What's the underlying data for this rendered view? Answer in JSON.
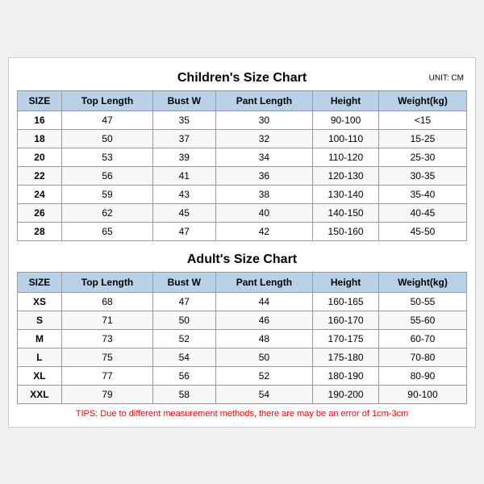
{
  "children": {
    "title": "Children's Size Chart",
    "unit": "UNIT: CM",
    "headers": [
      "SIZE",
      "Top Length",
      "Bust W",
      "Pant Length",
      "Height",
      "Weight(kg)"
    ],
    "rows": [
      [
        "16",
        "47",
        "35",
        "30",
        "90-100",
        "<15"
      ],
      [
        "18",
        "50",
        "37",
        "32",
        "100-110",
        "15-25"
      ],
      [
        "20",
        "53",
        "39",
        "34",
        "110-120",
        "25-30"
      ],
      [
        "22",
        "56",
        "41",
        "36",
        "120-130",
        "30-35"
      ],
      [
        "24",
        "59",
        "43",
        "38",
        "130-140",
        "35-40"
      ],
      [
        "26",
        "62",
        "45",
        "40",
        "140-150",
        "40-45"
      ],
      [
        "28",
        "65",
        "47",
        "42",
        "150-160",
        "45-50"
      ]
    ]
  },
  "adults": {
    "title": "Adult's Size Chart",
    "headers": [
      "SIZE",
      "Top Length",
      "Bust W",
      "Pant Length",
      "Height",
      "Weight(kg)"
    ],
    "rows": [
      [
        "XS",
        "68",
        "47",
        "44",
        "160-165",
        "50-55"
      ],
      [
        "S",
        "71",
        "50",
        "46",
        "160-170",
        "55-60"
      ],
      [
        "M",
        "73",
        "52",
        "48",
        "170-175",
        "60-70"
      ],
      [
        "L",
        "75",
        "54",
        "50",
        "175-180",
        "70-80"
      ],
      [
        "XL",
        "77",
        "56",
        "52",
        "180-190",
        "80-90"
      ],
      [
        "XXL",
        "79",
        "58",
        "54",
        "190-200",
        "90-100"
      ]
    ]
  },
  "tips": "TIPS: Due to different measurement methods, there are may be an error of 1cm-3cm"
}
